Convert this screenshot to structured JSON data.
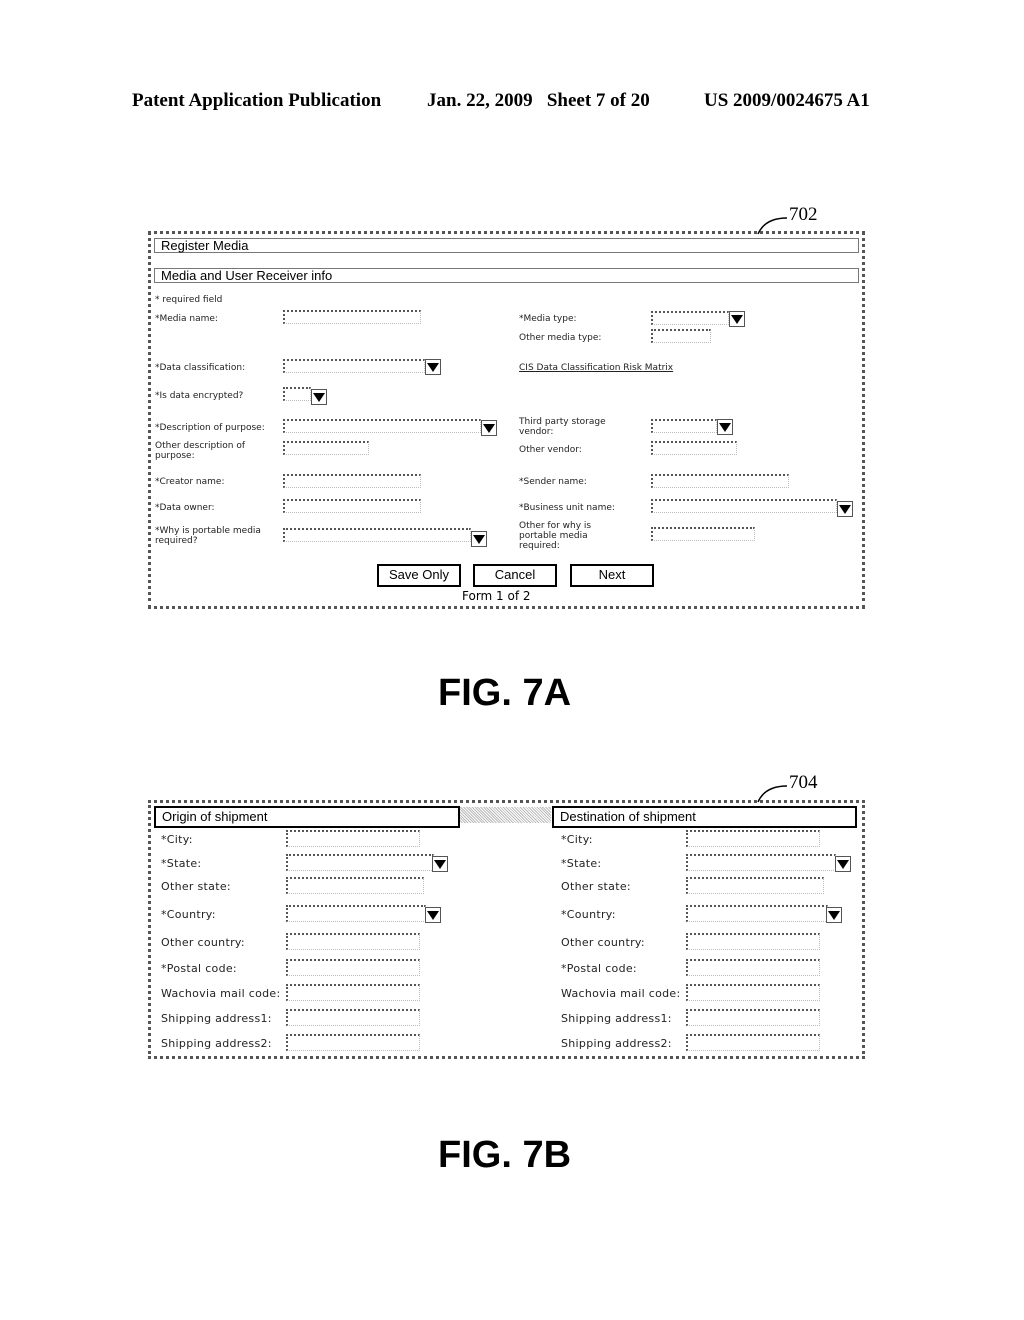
{
  "header": {
    "publication": "Patent Application Publication",
    "date_sheet": "Jan. 22, 2009   Sheet 7 of 20",
    "patent_number": "US 2009/0024675 A1"
  },
  "fig7a": {
    "ref_number": "702",
    "title_bar": "Register Media",
    "section_bar": "Media and User Receiver info",
    "required_note": "* required field",
    "fields": {
      "media_name": "*Media name:",
      "media_type": "*Media type:",
      "other_media_type": "Other media type:",
      "data_classification": "*Data classification:",
      "risk_matrix_link": "CIS Data Classification Risk Matrix",
      "is_encrypted": "*Is data encrypted?",
      "description_purpose": "*Description of purpose:",
      "other_description_1": "Other description of",
      "other_description_2": "purpose:",
      "third_party_1": "Third party storage",
      "third_party_2": "vendor:",
      "other_vendor": "Other vendor:",
      "creator_name": "*Creator name:",
      "sender_name": "*Sender name:",
      "data_owner": "*Data owner:",
      "business_unit": "*Business unit name:",
      "why_portable_1": "*Why is portable media",
      "why_portable_2": "required?",
      "other_why_1": "Other for why is",
      "other_why_2": "portable media",
      "other_why_3": "required:"
    },
    "buttons": {
      "save_only": "Save Only",
      "cancel": "Cancel",
      "next": "Next"
    },
    "form_progress": "Form 1 of 2",
    "caption": "FIG. 7A"
  },
  "fig7b": {
    "ref_number": "704",
    "origin": {
      "title": "Origin of shipment",
      "labels": [
        "*City:",
        "*State:",
        "Other state:",
        "*Country:",
        "Other country:",
        "*Postal code:",
        "Wachovia mail code:",
        "Shipping address1:",
        "Shipping address2:"
      ]
    },
    "destination": {
      "title": "Destination of shipment",
      "labels": [
        "*City:",
        "*State:",
        "Other state:",
        "*Country:",
        "Other country:",
        "*Postal code:",
        "Wachovia mail code:",
        "Shipping address1:",
        "Shipping address2:"
      ]
    },
    "caption": "FIG. 7B"
  },
  "icons": {
    "dropdown": "chevron-down-icon (black down triangle)"
  }
}
